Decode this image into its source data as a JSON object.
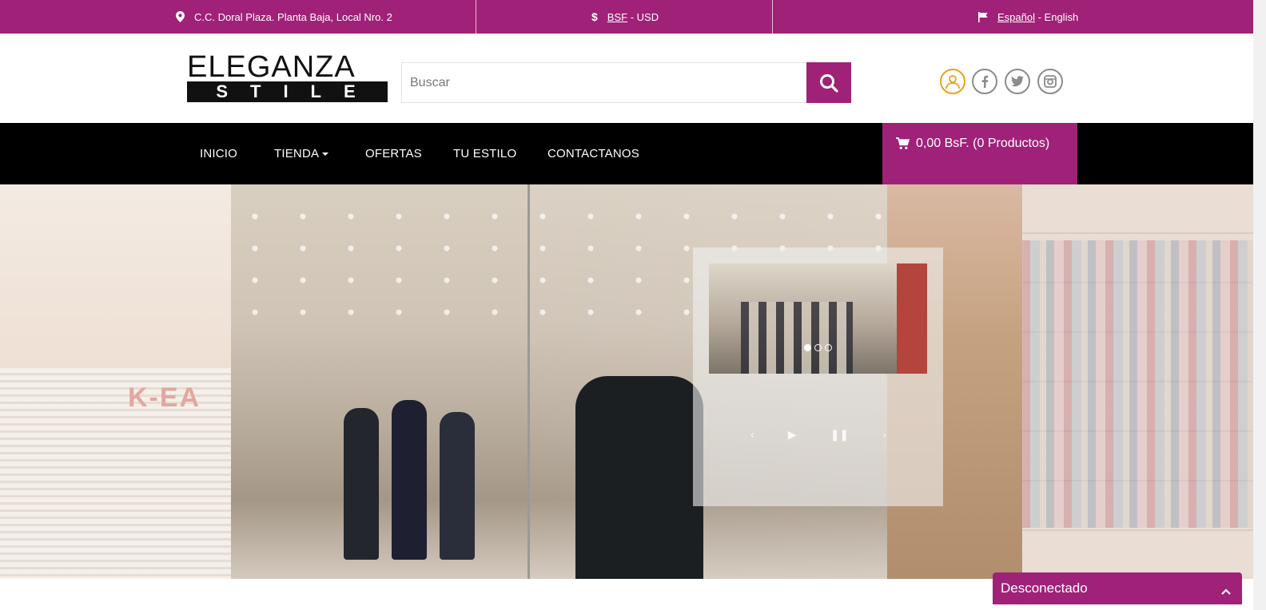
{
  "topbar": {
    "address": "C.C. Doral Plaza. Planta Baja, Local Nro. 2",
    "currency_active": "BSF",
    "currency_sep": " - ",
    "currency_other": "USD",
    "lang_active": "Español",
    "lang_sep": " - ",
    "lang_other": "English",
    "icons": [
      "map-pin-icon",
      "dollar-icon",
      "flag-icon"
    ]
  },
  "header": {
    "logo_line1": "ELEGANZA",
    "logo_line2": "STILE",
    "search_placeholder": "Buscar",
    "search_value": "",
    "social": [
      "user-icon",
      "facebook-icon",
      "twitter-icon",
      "instagram-icon"
    ]
  },
  "nav": {
    "items": [
      "INICIO",
      "TIENDA",
      "OFERTAS",
      "TU ESTILO",
      "CONTACTANOS"
    ],
    "cart": "0,00 BsF. (0 Productos)"
  },
  "hero": {
    "slides_total": 3,
    "slide_active": 1,
    "controls": [
      "‹",
      "▶",
      "❚❚",
      "›"
    ]
  },
  "chat": {
    "status": "Desconectado"
  },
  "colors": {
    "brand": "#a02178",
    "nav_bg": "#000000",
    "user_icon": "#e7a21c"
  }
}
